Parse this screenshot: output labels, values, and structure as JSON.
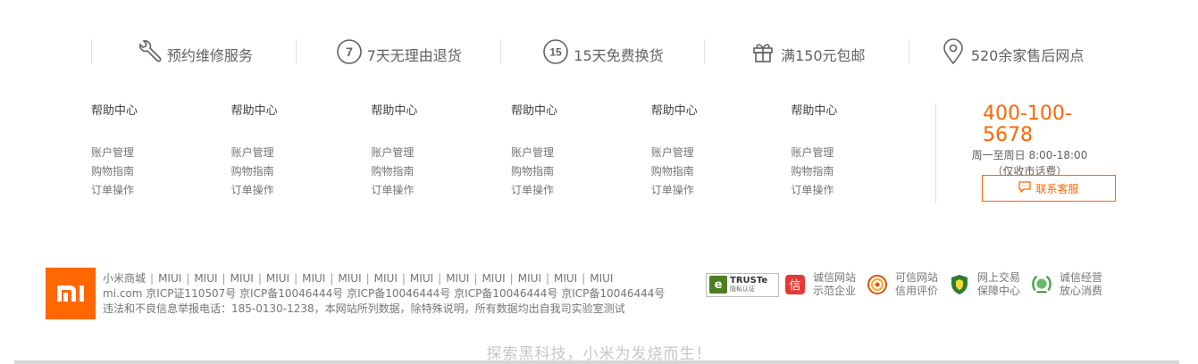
{
  "services": [
    {
      "icon": "wrench-icon",
      "label": "预约维修服务"
    },
    {
      "icon": "seven-day-icon",
      "label": "7天无理由退货"
    },
    {
      "icon": "fifteen-day-icon",
      "label": "15天免费换货"
    },
    {
      "icon": "gift-icon",
      "label": "满150元包邮"
    },
    {
      "icon": "location-pin-icon",
      "label": "520余家售后网点"
    }
  ],
  "service_icon_text": {
    "seven": "7",
    "fifteen": "15"
  },
  "columns": [
    {
      "title": "帮助中心",
      "items": [
        "账户管理",
        "购物指南",
        "订单操作"
      ]
    },
    {
      "title": "帮助中心",
      "items": [
        "账户管理",
        "购物指南",
        "订单操作"
      ]
    },
    {
      "title": "帮助中心",
      "items": [
        "账户管理",
        "购物指南",
        "订单操作"
      ]
    },
    {
      "title": "帮助中心",
      "items": [
        "账户管理",
        "购物指南",
        "订单操作"
      ]
    },
    {
      "title": "帮助中心",
      "items": [
        "账户管理",
        "购物指南",
        "订单操作"
      ]
    },
    {
      "title": "帮助中心",
      "items": [
        "账户管理",
        "购物指南",
        "订单操作"
      ]
    }
  ],
  "contact": {
    "phone": "400-100-5678",
    "hours": "周一至周日 8:00-18:00",
    "note": "（仅收市话费）",
    "button": "联系客服"
  },
  "footer": {
    "links": [
      "小米商城",
      "MIUI",
      "MIUI",
      "MIUI",
      "MIUI",
      "MIUI",
      "MIUI",
      "MIUI",
      "MIUI",
      "MIUI",
      "MIUI",
      "MIUI",
      "MIUI",
      "MIUI"
    ],
    "icp_line": "mi.com 京ICP证110507号 京ICP备10046444号 京ICP备10046444号 京ICP备10046444号 京ICP备10046444号",
    "report_line": "违法和不良信息举报电话：185-0130-1238，本网站所列数据，除特殊说明，所有数据均出自我司实验室测试",
    "logo_text": "mi"
  },
  "badges": {
    "truste": {
      "title": "TRUSTe",
      "sub": "隐私认证",
      "mark": "e"
    },
    "items": [
      {
        "icon": "credit-seal-icon",
        "glyph": "信",
        "line1": "诚信网站",
        "line2": "示范企业"
      },
      {
        "icon": "trusted-site-icon",
        "line1": "可信网站",
        "line2": "信用评价"
      },
      {
        "icon": "police-shield-icon",
        "line1": "网上交易",
        "line2": "保障中心"
      },
      {
        "icon": "integrity-laurel-icon",
        "line1": "诚信经营",
        "line2": "放心消费"
      }
    ]
  },
  "slogan": "探索黑科技，小米为发烧而生！",
  "colors": {
    "accent": "#ff6700",
    "text": "#757575",
    "divider": "#e0e0e0"
  }
}
